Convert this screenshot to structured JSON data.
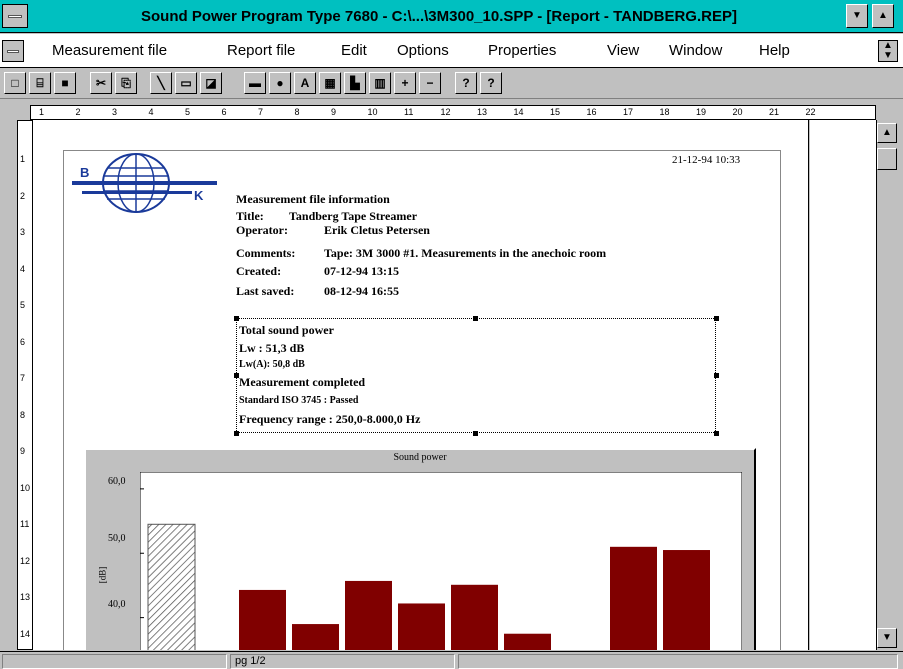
{
  "window": {
    "title": "Sound Power Program Type 7680 - C:\\...\\3M300_10.SPP - [Report - TANDBERG.REP]"
  },
  "menu": {
    "items": [
      {
        "label": "Measurement file"
      },
      {
        "label": "Report file"
      },
      {
        "label": "Edit"
      },
      {
        "label": "Options"
      },
      {
        "label": "Properties"
      },
      {
        "label": "View"
      },
      {
        "label": "Window"
      },
      {
        "label": "Help"
      }
    ]
  },
  "toolbar": {
    "text_tool": "A",
    "plus_tool": "+",
    "minus_tool": "−",
    "help_tool": "?",
    "context_help_tool": "?"
  },
  "ruler": {
    "h_ticks": [
      "1",
      "2",
      "3",
      "4",
      "5",
      "6",
      "7",
      "8",
      "9",
      "10",
      "11",
      "12",
      "13",
      "14",
      "15",
      "16",
      "17",
      "18",
      "19",
      "20",
      "21",
      "22"
    ],
    "v_ticks": [
      "1",
      "2",
      "3",
      "4",
      "5",
      "6",
      "7",
      "8",
      "9",
      "10",
      "11",
      "12",
      "13",
      "14"
    ]
  },
  "report": {
    "timestamp": "21-12-94 10:33",
    "logo_letters": [
      "B",
      "K"
    ],
    "info_heading": "Measurement file information",
    "title_label": "Title:",
    "title_value": "Tandberg Tape Streamer",
    "operator_label": "Operator:",
    "operator_value": "Erik Cletus Petersen",
    "comments_label": "Comments:",
    "comments_value": "Tape: 3M 3000 #1.  Measurements in the anechoic room",
    "created_label": "Created:",
    "created_value": "07-12-94  13:15",
    "saved_label": "Last saved:",
    "saved_value": "08-12-94  16:55",
    "total_power_heading": "Total sound power",
    "lw_line": "Lw   : 51,3 dB",
    "lwa_line": "Lw(A): 50,8 dB",
    "completed_line": "Measurement completed",
    "standard_line": "Standard ISO 3745  : Passed",
    "freq_line": "Frequency range : 250,0-8.000,0 Hz"
  },
  "chart_data": {
    "type": "bar",
    "title": "Sound power",
    "ylabel": "[dB]",
    "yticks": [
      "60,0",
      "50,0",
      "40,0"
    ],
    "ylim": [
      30,
      62
    ],
    "values": [
      54.5,
      44.3,
      39.0,
      45.7,
      42.2,
      45.1,
      37.5,
      null,
      51.0,
      50.5
    ],
    "colors": {
      "total": "hatched",
      "band": "#800000"
    }
  },
  "status": {
    "page": "pg 1/2"
  }
}
